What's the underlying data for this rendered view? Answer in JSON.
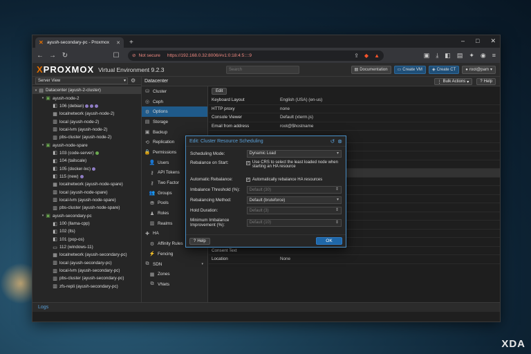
{
  "browser": {
    "tab_title": "ayush-secondary-pc - Proxmox",
    "not_secure": "Not secure",
    "url": "https://192.168.0.32:8006/#v1:0:18:4:5::::9"
  },
  "header": {
    "logo_x": "X",
    "logo_rest": "PROXMOX",
    "version": "Virtual Environment 9.2.3",
    "search_placeholder": "Search",
    "buttons": [
      "Documentation",
      "Create VM",
      "Create CT",
      "root@pam"
    ]
  },
  "server_view": "Server View",
  "tree": [
    {
      "label": "Datacenter (ayush-2-cluster)",
      "icon": "datacenter-icon",
      "glyph": "▤",
      "indent": 0,
      "tw": "▾",
      "selected": true
    },
    {
      "label": "ayush-node-2",
      "icon": "node-icon",
      "glyph": "▣",
      "indent": 1,
      "tw": "▾",
      "green": true
    },
    {
      "label": "106 (debian)",
      "icon": "vm-icon",
      "glyph": "◧",
      "indent": 2,
      "dots": [
        "#8e7cc3",
        "#8e7cc3",
        "#8e7cc3"
      ]
    },
    {
      "label": "localnetwork (ayush-node-2)",
      "icon": "network-icon",
      "glyph": "▦",
      "indent": 2
    },
    {
      "label": "local (ayush-node-2)",
      "icon": "storage-icon",
      "glyph": "▥",
      "indent": 2
    },
    {
      "label": "local-lvm (ayush-node-2)",
      "icon": "storage-icon",
      "glyph": "▥",
      "indent": 2
    },
    {
      "label": "pbs-cluster (ayush-node-2)",
      "icon": "storage-icon",
      "glyph": "▥",
      "indent": 2
    },
    {
      "label": "ayush-node-spare",
      "icon": "node-icon",
      "glyph": "▣",
      "indent": 1,
      "tw": "▾",
      "green": true
    },
    {
      "label": "103 (code-server)",
      "icon": "vm-icon",
      "glyph": "◧",
      "indent": 2,
      "dots": [
        "#6aa84f"
      ]
    },
    {
      "label": "104 (tailscale)",
      "icon": "vm-icon",
      "glyph": "◧",
      "indent": 2
    },
    {
      "label": "105 (docker-lxc)",
      "icon": "vm-icon",
      "glyph": "◧",
      "indent": 2,
      "dots": [
        "#8e7cc3"
      ]
    },
    {
      "label": "115 (new)",
      "icon": "vm-icon",
      "glyph": "◧",
      "indent": 2,
      "dots": [
        "#8e7cc3"
      ]
    },
    {
      "label": "localnetwork (ayush-node-spare)",
      "icon": "network-icon",
      "glyph": "▦",
      "indent": 2
    },
    {
      "label": "local (ayush-node-spare)",
      "icon": "storage-icon",
      "glyph": "▥",
      "indent": 2
    },
    {
      "label": "local-lvm (ayush-node-spare)",
      "icon": "storage-icon",
      "glyph": "▥",
      "indent": 2
    },
    {
      "label": "pbs-cluster (ayush-node-spare)",
      "icon": "storage-icon",
      "glyph": "▥",
      "indent": 2
    },
    {
      "label": "ayush-secondary-pc",
      "icon": "node-icon",
      "glyph": "▣",
      "indent": 1,
      "tw": "▾",
      "green": true
    },
    {
      "label": "100 (llama-cpp)",
      "icon": "vm-icon",
      "glyph": "◧",
      "indent": 2
    },
    {
      "label": "102 (lts)",
      "icon": "vm-icon",
      "glyph": "◧",
      "indent": 2
    },
    {
      "label": "101 (pop-os)",
      "icon": "vm-icon",
      "glyph": "◧",
      "indent": 2
    },
    {
      "label": "112 (windows-11)",
      "icon": "monitor-icon",
      "glyph": "▭",
      "indent": 2
    },
    {
      "label": "localnetwork (ayush-secondary-pc)",
      "icon": "network-icon",
      "glyph": "▦",
      "indent": 2
    },
    {
      "label": "local (ayush-secondary-pc)",
      "icon": "storage-icon",
      "glyph": "▥",
      "indent": 2
    },
    {
      "label": "local-lvm (ayush-secondary-pc)",
      "icon": "storage-icon",
      "glyph": "▥",
      "indent": 2
    },
    {
      "label": "pbs-cluster (ayush-secondary-pc)",
      "icon": "storage-icon",
      "glyph": "▥",
      "indent": 2
    },
    {
      "label": "zfs-repli (ayush-secondary-pc)",
      "icon": "storage-icon",
      "glyph": "▥",
      "indent": 2
    }
  ],
  "content_header": {
    "title": "Datacenter",
    "bulk_actions": "Bulk Actions",
    "help": "Help"
  },
  "menu": [
    {
      "label": "Cluster",
      "icon": "cluster-icon",
      "glyph": "⛁"
    },
    {
      "label": "Ceph",
      "icon": "ceph-icon",
      "glyph": "◎"
    },
    {
      "label": "Options",
      "icon": "gear-icon",
      "glyph": "⚙",
      "active": true
    },
    {
      "label": "Storage",
      "icon": "storage-icon",
      "glyph": "▤"
    },
    {
      "label": "Backup",
      "icon": "backup-icon",
      "glyph": "▣"
    },
    {
      "label": "Replication",
      "icon": "replication-icon",
      "glyph": "⟲"
    },
    {
      "label": "Permissions",
      "icon": "lock-icon",
      "glyph": "🔒",
      "arrow": "▾"
    },
    {
      "label": "Users",
      "icon": "user-icon",
      "glyph": "👤",
      "sub": true
    },
    {
      "label": "API Tokens",
      "icon": "key-icon",
      "glyph": "⚷",
      "sub": true
    },
    {
      "label": "Two Factor",
      "icon": "key-icon",
      "glyph": "⚷",
      "sub": true
    },
    {
      "label": "Groups",
      "icon": "group-icon",
      "glyph": "👥",
      "sub": true
    },
    {
      "label": "Pools",
      "icon": "pool-icon",
      "glyph": "⛃",
      "sub": true
    },
    {
      "label": "Roles",
      "icon": "role-icon",
      "glyph": "♟",
      "sub": true
    },
    {
      "label": "Realms",
      "icon": "realm-icon",
      "glyph": "▥",
      "sub": true
    },
    {
      "label": "HA",
      "icon": "ha-icon",
      "glyph": "✚",
      "arrow": "▾"
    },
    {
      "label": "Affinity Rules",
      "icon": "affinity-icon",
      "glyph": "⚙",
      "sub": true
    },
    {
      "label": "Fencing",
      "icon": "fencing-icon",
      "glyph": "⚡",
      "sub": true
    },
    {
      "label": "SDN",
      "icon": "sdn-icon",
      "glyph": "⧉",
      "arrow": "▾"
    },
    {
      "label": "Zones",
      "icon": "zones-icon",
      "glyph": "▦",
      "sub": true
    },
    {
      "label": "VNets",
      "icon": "vnets-icon",
      "glyph": "⧉",
      "sub": true
    }
  ],
  "edit_label": "Edit",
  "options": [
    {
      "k": "Keyboard Layout",
      "v": "English (USA) (en-us)"
    },
    {
      "k": "HTTP proxy",
      "v": "none"
    },
    {
      "k": "Console Viewer",
      "v": "Default (xterm.js)"
    },
    {
      "k": "Email from address",
      "v": "root@$hostname"
    }
  ],
  "options_bottom": [
    {
      "k": "Consent Text",
      "v": ""
    },
    {
      "k": "Location",
      "v": "None"
    }
  ],
  "logs_label": "Logs",
  "modal": {
    "title": "Edit: Cluster Resource Scheduling",
    "scheduling_mode_label": "Scheduling Mode:",
    "scheduling_mode_value": "Dynamic Load",
    "rebalance_start_label": "Rebalance on Start:",
    "rebalance_start_text": "Use CRS to select the least loaded node when starting an HA resource",
    "auto_rebalance_label": "Automatic Rebalance:",
    "auto_rebalance_text": "Automatically rebalance HA resources",
    "imbalance_threshold_label": "Imbalance Threshold (%):",
    "imbalance_threshold_value": "Default (30)",
    "rebalancing_method_label": "Rebalancing Method:",
    "rebalancing_method_value": "Default (bruteforce)",
    "hold_duration_label": "Hold Duration:",
    "hold_duration_value": "Default (3)",
    "min_imbalance_label": "Minimum Imbalance Improvement (%):",
    "min_imbalance_value": "Default (10)",
    "help": "Help",
    "ok": "OK"
  },
  "watermark": "XDA"
}
